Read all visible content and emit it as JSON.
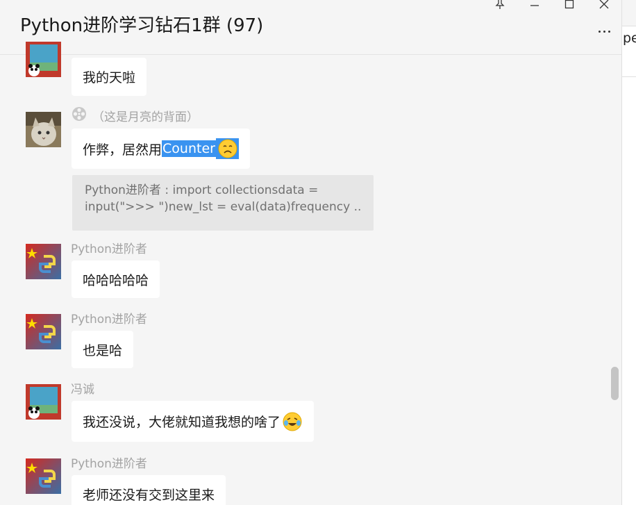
{
  "header": {
    "title": "Python进阶学习钻石1群 (97)"
  },
  "window_controls": {
    "pin_icon": "pin-icon",
    "minimize_icon": "minimize-icon",
    "maximize_icon": "maximize-icon",
    "close_icon": "close-icon",
    "more_icon": "more-icon"
  },
  "right_panel": {
    "fragment": "pe"
  },
  "messages": [
    {
      "sender": "",
      "text": "我的天啦"
    },
    {
      "sender": "（这是月亮的背面）",
      "text_prefix": "作弊，居然用",
      "selected": "Counter"
    },
    {
      "quote_line1": "Python进阶者 : import collectionsdata =",
      "quote_line2": "input(\">>> \")new_lst = eval(data)frequency ..."
    },
    {
      "sender": "Python进阶者",
      "text": "哈哈哈哈哈"
    },
    {
      "sender": "Python进阶者",
      "text": "也是哈"
    },
    {
      "sender": "冯诚",
      "text": "我还没说，大佬就知道我想的啥了"
    },
    {
      "sender": "Python进阶者",
      "text": "老师还没有交到这里来"
    }
  ],
  "colors": {
    "background": "#f5f5f5",
    "bubble": "#ffffff",
    "selection": "#3a93f0",
    "sender": "#a3a3a3"
  }
}
